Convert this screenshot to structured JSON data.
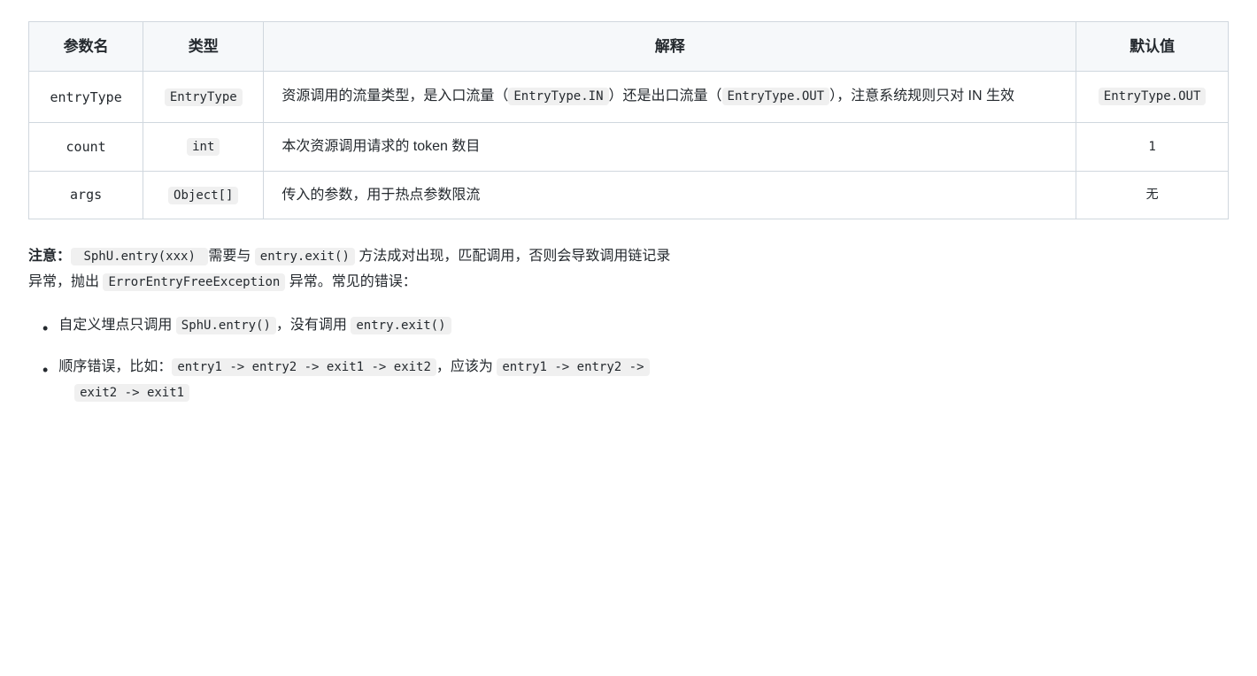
{
  "table": {
    "headers": [
      "参数名",
      "类型",
      "解释",
      "默认值"
    ],
    "rows": [
      {
        "param": "entryType",
        "type": "EntryType",
        "description_parts": [
          "资源调用的流量类型，是入口流量（",
          "EntryType.IN",
          "）还是出口流量（",
          "EntryType.OUT",
          "），注意系统规则只对 IN 生效"
        ],
        "default_code": "EntryType.OUT"
      },
      {
        "param": "count",
        "type": "int",
        "description": "本次资源调用请求的 token 数目",
        "default": "1"
      },
      {
        "param": "args",
        "type": "Object[]",
        "description": "传入的参数，用于热点参数限流",
        "default": "无"
      }
    ]
  },
  "notice": {
    "label": "注意：",
    "text1": " SphU.entry(xxx) 需要与 ",
    "code1": "entry.exit()",
    "text2": " 方法成对出现，匹配调用，否则会导致调用链记录异常，抛出 ",
    "code2": "ErrorEntryFreeException",
    "text3": " 异常。常见的错误："
  },
  "bullets": [
    {
      "text_before": "自定义埋点只调用 ",
      "code1": "SphU.entry()",
      "text_after": "，没有调用 ",
      "code2": "entry.exit()"
    },
    {
      "text_before": "顺序错误，比如：",
      "code1": "entry1 -> entry2 -> exit1 -> exit2",
      "text_middle": "，应该为 ",
      "code2": "entry1 -> entry2 -> exit2 -> exit1"
    }
  ]
}
